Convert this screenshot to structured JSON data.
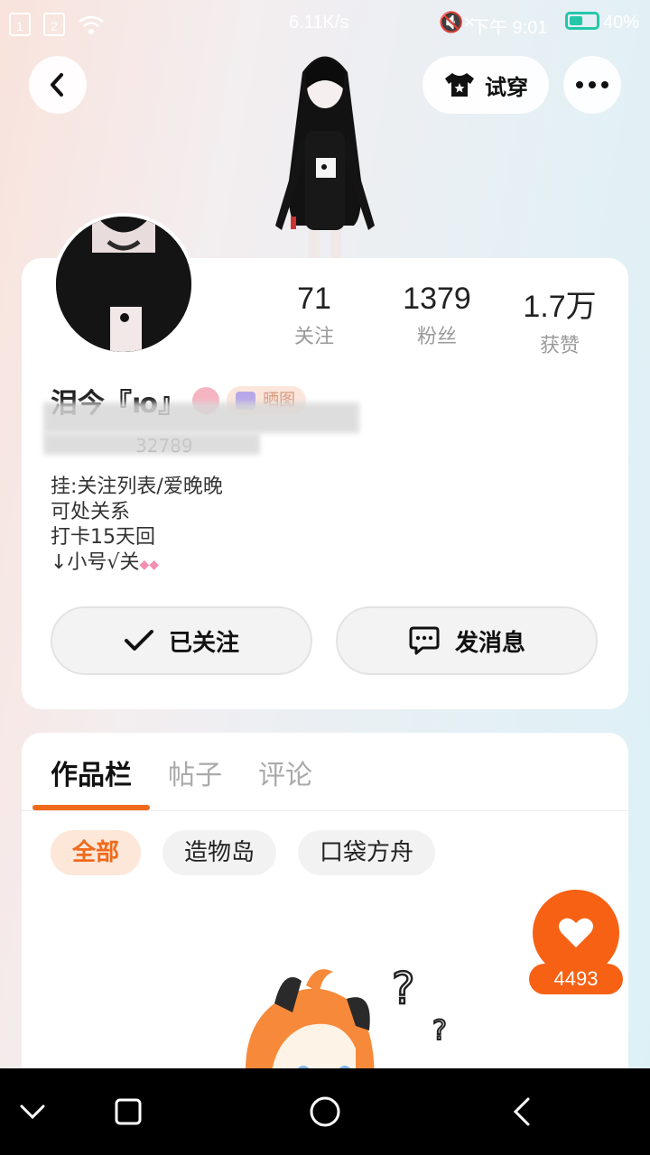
{
  "status_bar": {
    "sim1": "1",
    "sim2": "2",
    "net_speed": "6.11K/s",
    "mute": "🔇×",
    "time": "下午 9:01",
    "battery": "40%"
  },
  "header": {
    "try_on_label": "试穿"
  },
  "stats": [
    {
      "value": "71",
      "label": "关注"
    },
    {
      "value": "1379",
      "label": "粉丝"
    },
    {
      "value": "1.7万",
      "label": "获赞"
    }
  ],
  "profile": {
    "nickname": "泪今『ю』",
    "medal_text": "晒图",
    "id_text": "32789",
    "bio": [
      "挂:关注列表/爱晚晚",
      "可处关系",
      "打卡15天回",
      "↓小号√关"
    ]
  },
  "actions": {
    "followed_label": "已关注",
    "message_label": "发消息"
  },
  "tabs": [
    "作品栏",
    "帖子",
    "评论"
  ],
  "chips": [
    "全部",
    "造物岛",
    "口袋方舟"
  ],
  "like": {
    "count": "4493"
  },
  "colors": {
    "accent": "#f76114",
    "tab_accent": "#f06a1c"
  }
}
